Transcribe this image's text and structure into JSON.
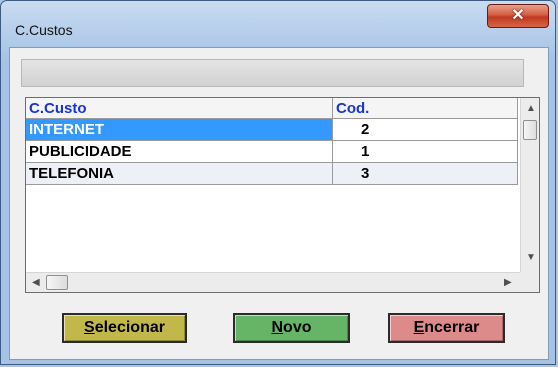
{
  "window": {
    "title": "C.Custos",
    "close_icon": "close-icon"
  },
  "grid": {
    "columns": [
      "C.Custo",
      "Cod."
    ],
    "rows": [
      {
        "name": "INTERNET",
        "code": "2",
        "selected": true
      },
      {
        "name": "PUBLICIDADE",
        "code": "1",
        "selected": false
      },
      {
        "name": "TELEFONIA",
        "code": "3",
        "selected": false
      }
    ]
  },
  "buttons": {
    "selecionar": {
      "mnemonic": "S",
      "rest": "elecionar"
    },
    "novo": {
      "mnemonic": "N",
      "rest": "ovo"
    },
    "encerrar": {
      "mnemonic": "E",
      "rest": "ncerrar"
    }
  },
  "colors": {
    "selecionar": "#c2b84a",
    "novo": "#66b466",
    "encerrar": "#dd8a8a",
    "selection": "#3399ff",
    "header_text": "#1a33d6"
  }
}
